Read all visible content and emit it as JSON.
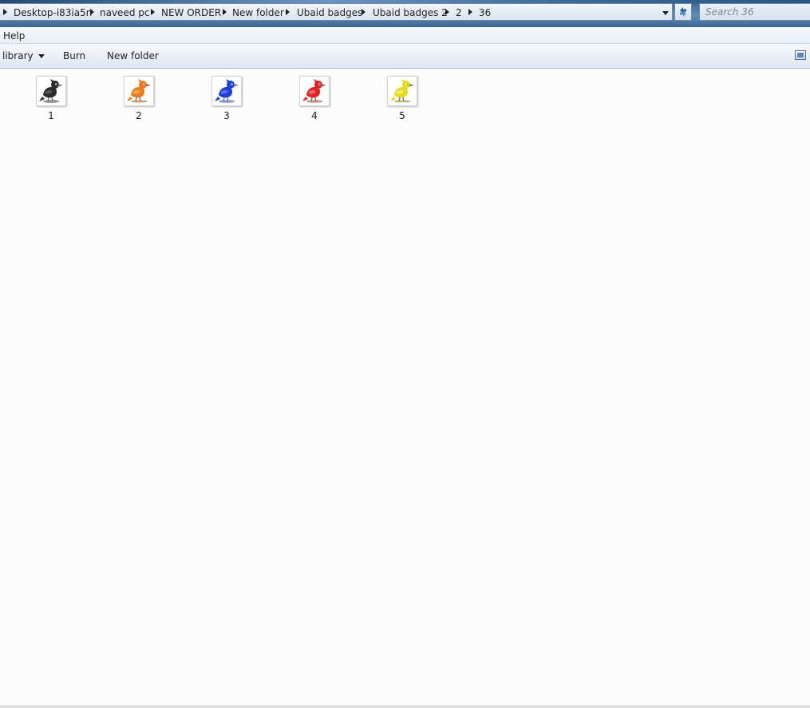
{
  "address_bar": {
    "breadcrumbs": [
      {
        "label": "Desktop-i83ia5n"
      },
      {
        "label": "naveed pc"
      },
      {
        "label": "NEW ORDER"
      },
      {
        "label": "New folder"
      },
      {
        "label": "Ubaid badges"
      },
      {
        "label": "Ubaid badges 2"
      },
      {
        "label": "2"
      },
      {
        "label": "36"
      }
    ],
    "dropdown_icon": "chevron-down-icon",
    "refresh_icon": "refresh-icon"
  },
  "search": {
    "placeholder": "Search 36"
  },
  "menubar": {
    "items": [
      {
        "label": "Help"
      }
    ]
  },
  "commandbar": {
    "library_label": "library",
    "burn_label": "Burn",
    "new_folder_label": "New folder",
    "preview_pane_icon": "preview-pane-icon"
  },
  "files": [
    {
      "name": "1",
      "color": "#2b2b2b",
      "accent": "#5a5a5a"
    },
    {
      "name": "2",
      "color": "#f07a1a",
      "accent": "#f9b25a"
    },
    {
      "name": "3",
      "color": "#1e3fd6",
      "accent": "#5b78f0"
    },
    {
      "name": "4",
      "color": "#e02424",
      "accent": "#f07070"
    },
    {
      "name": "5",
      "color": "#e6dc1e",
      "accent": "#f4ee7a"
    }
  ]
}
